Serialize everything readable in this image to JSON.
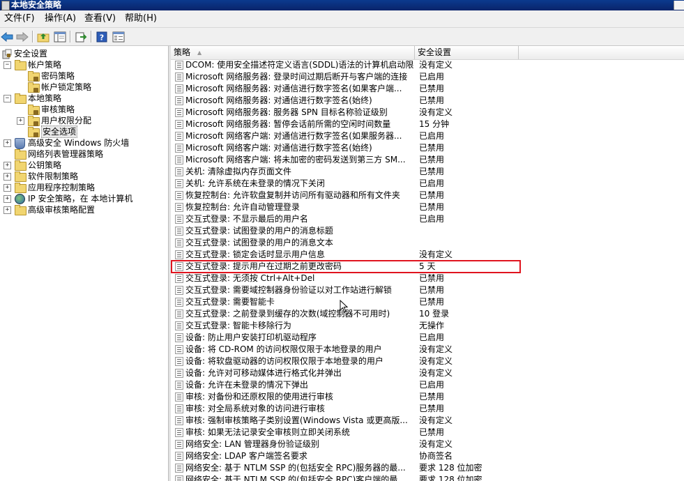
{
  "window": {
    "title": "本地安全策略"
  },
  "menu": [
    "文件(F)",
    "操作(A)",
    "查看(V)",
    "帮助(H)"
  ],
  "toolbar": {
    "buttons": [
      "back-icon",
      "forward-icon",
      "up-folder-icon",
      "show-hide-tree-icon",
      "export-list-icon",
      "help-icon",
      "properties-icon"
    ]
  },
  "tree": {
    "root": "安全设置",
    "items": [
      {
        "label": "帐户策略",
        "level": 1,
        "expander": "−",
        "icon": "folder-icon"
      },
      {
        "label": "密码策略",
        "level": 2,
        "expander": "",
        "icon": "folder-icon"
      },
      {
        "label": "帐户锁定策略",
        "level": 2,
        "expander": "",
        "icon": "folder-icon"
      },
      {
        "label": "本地策略",
        "level": 1,
        "expander": "−",
        "icon": "folder-icon"
      },
      {
        "label": "审核策略",
        "level": 2,
        "expander": "",
        "icon": "folder-icon"
      },
      {
        "label": "用户权限分配",
        "level": 2,
        "expander": "+",
        "icon": "folder-icon"
      },
      {
        "label": "安全选项",
        "level": 2,
        "expander": "",
        "icon": "folder-icon",
        "selected": true
      },
      {
        "label": "高级安全 Windows 防火墙",
        "level": 1,
        "expander": "+",
        "icon": "firewall-icon"
      },
      {
        "label": "网络列表管理器策略",
        "level": 1,
        "expander": "",
        "icon": "folder-icon"
      },
      {
        "label": "公钥策略",
        "level": 1,
        "expander": "+",
        "icon": "folder-icon"
      },
      {
        "label": "软件限制策略",
        "level": 1,
        "expander": "+",
        "icon": "folder-icon"
      },
      {
        "label": "应用程序控制策略",
        "level": 1,
        "expander": "+",
        "icon": "folder-icon"
      },
      {
        "label": "IP 安全策略，在 本地计算机",
        "level": 1,
        "expander": "+",
        "icon": "ip-security-icon"
      },
      {
        "label": "高级审核策略配置",
        "level": 1,
        "expander": "+",
        "icon": "folder-icon"
      }
    ]
  },
  "list": {
    "columns": {
      "policy": "策略",
      "setting": "安全设置"
    },
    "rows": [
      {
        "policy": "DCOM: 使用安全描述符定义语言(SDDL)语法的计算机启动限制",
        "setting": "没有定义"
      },
      {
        "policy": "Microsoft 网络服务器: 登录时间过期后断开与客户端的连接",
        "setting": "已启用"
      },
      {
        "policy": "Microsoft 网络服务器: 对通信进行数字签名(如果客户端...",
        "setting": "已禁用"
      },
      {
        "policy": "Microsoft 网络服务器: 对通信进行数字签名(始终)",
        "setting": "已禁用"
      },
      {
        "policy": "Microsoft 网络服务器: 服务器 SPN 目标名称验证级别",
        "setting": "没有定义"
      },
      {
        "policy": "Microsoft 网络服务器: 暂停会话前所需的空闲时间数量",
        "setting": "15 分钟"
      },
      {
        "policy": "Microsoft 网络客户端: 对通信进行数字签名(如果服务器...",
        "setting": "已启用"
      },
      {
        "policy": "Microsoft 网络客户端: 对通信进行数字签名(始终)",
        "setting": "已禁用"
      },
      {
        "policy": "Microsoft 网络客户端: 将未加密的密码发送到第三方 SM...",
        "setting": "已禁用"
      },
      {
        "policy": "关机: 清除虚拟内存页面文件",
        "setting": "已禁用"
      },
      {
        "policy": "关机: 允许系统在未登录的情况下关闭",
        "setting": "已启用"
      },
      {
        "policy": "恢复控制台: 允许软盘复制并访问所有驱动器和所有文件夹",
        "setting": "已禁用"
      },
      {
        "policy": "恢复控制台: 允许自动管理登录",
        "setting": "已禁用"
      },
      {
        "policy": "交互式登录: 不显示最后的用户名",
        "setting": "已启用"
      },
      {
        "policy": "交互式登录: 试图登录的用户的消息标题",
        "setting": ""
      },
      {
        "policy": "交互式登录: 试图登录的用户的消息文本",
        "setting": ""
      },
      {
        "policy": "交互式登录: 锁定会话时显示用户信息",
        "setting": "没有定义"
      },
      {
        "policy": "交互式登录: 提示用户在过期之前更改密码",
        "setting": "5 天"
      },
      {
        "policy": "交互式登录: 无须按 Ctrl+Alt+Del",
        "setting": "已禁用"
      },
      {
        "policy": "交互式登录: 需要域控制器身份验证以对工作站进行解锁",
        "setting": "已禁用"
      },
      {
        "policy": "交互式登录: 需要智能卡",
        "setting": "已禁用"
      },
      {
        "policy": "交互式登录: 之前登录到缓存的次数(域控制器不可用时)",
        "setting": "10 登录"
      },
      {
        "policy": "交互式登录: 智能卡移除行为",
        "setting": "无操作"
      },
      {
        "policy": "设备: 防止用户安装打印机驱动程序",
        "setting": "已启用"
      },
      {
        "policy": "设备: 将 CD-ROM 的访问权限仅限于本地登录的用户",
        "setting": "没有定义"
      },
      {
        "policy": "设备: 将软盘驱动器的访问权限仅限于本地登录的用户",
        "setting": "没有定义"
      },
      {
        "policy": "设备: 允许对可移动媒体进行格式化并弹出",
        "setting": "没有定义"
      },
      {
        "policy": "设备: 允许在未登录的情况下弹出",
        "setting": "已启用"
      },
      {
        "policy": "审核: 对备份和还原权限的使用进行审核",
        "setting": "已禁用"
      },
      {
        "policy": "审核: 对全局系统对象的访问进行审核",
        "setting": "已禁用"
      },
      {
        "policy": "审核: 强制审核策略子类别设置(Windows Vista 或更高版...",
        "setting": "没有定义"
      },
      {
        "policy": "审核: 如果无法记录安全审核则立即关闭系统",
        "setting": "已禁用"
      },
      {
        "policy": "网络安全: LAN 管理器身份验证级别",
        "setting": "没有定义"
      },
      {
        "policy": "网络安全: LDAP 客户端签名要求",
        "setting": "协商签名"
      },
      {
        "policy": "网络安全: 基于 NTLM SSP 的(包括安全 RPC)服务器的最...",
        "setting": "要求 128 位加密"
      },
      {
        "policy": "网络安全: 基于 NTLM SSP 的(包括安全 RPC)客户端的最...",
        "setting": "要求 128 位加密"
      }
    ]
  },
  "colors": {
    "highlight": "#e0141e",
    "titlebar": "#0a246a"
  }
}
